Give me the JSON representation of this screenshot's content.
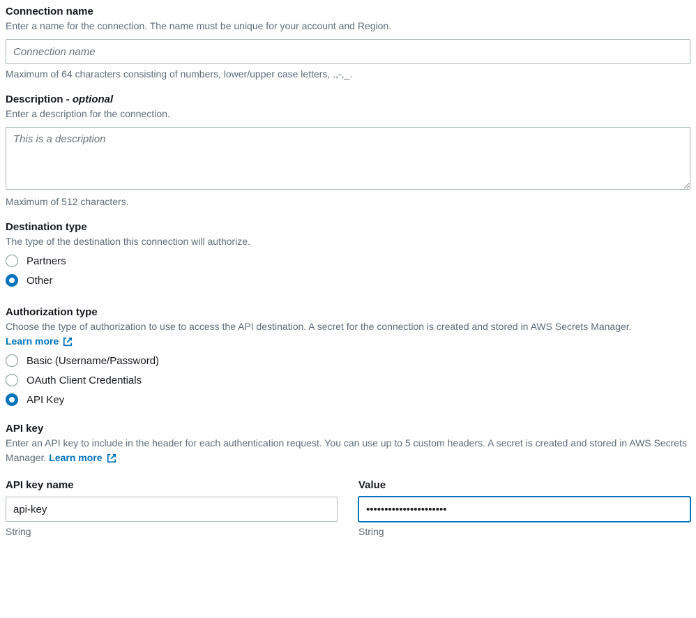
{
  "connName": {
    "label": "Connection name",
    "description": "Enter a name for the connection. The name must be unique for your account and Region.",
    "placeholder": "Connection name",
    "helper": "Maximum of 64 characters consisting of numbers, lower/upper case letters, .,-,_."
  },
  "description": {
    "label": "Description - ",
    "optional": "optional",
    "description": "Enter a description for the connection.",
    "placeholder": "This is a description",
    "helper": "Maximum of 512 characters."
  },
  "destType": {
    "label": "Destination type",
    "description": "The type of the destination this connection will authorize.",
    "options": {
      "partners": "Partners",
      "other": "Other"
    }
  },
  "authType": {
    "label": "Authorization type",
    "description": "Choose the type of authorization to use to access the API destination. A secret for the connection is created and stored in AWS Secrets Manager.  ",
    "learnMore": "Learn more",
    "options": {
      "basic": "Basic (Username/Password)",
      "oauth": "OAuth Client Credentials",
      "apikey": "API Key"
    }
  },
  "apiKey": {
    "label": "API key",
    "description": "Enter an API key to include in the header for each authentication request. You can use up to 5 custom headers. A secret is created and stored in AWS Secrets Manager.  ",
    "learnMore": "Learn more"
  },
  "apiKeyName": {
    "label": "API key name",
    "value": "api-key",
    "helper": "String"
  },
  "apiKeyValue": {
    "label": "Value",
    "value": "••••••••••••••••••••••",
    "helper": "String"
  }
}
